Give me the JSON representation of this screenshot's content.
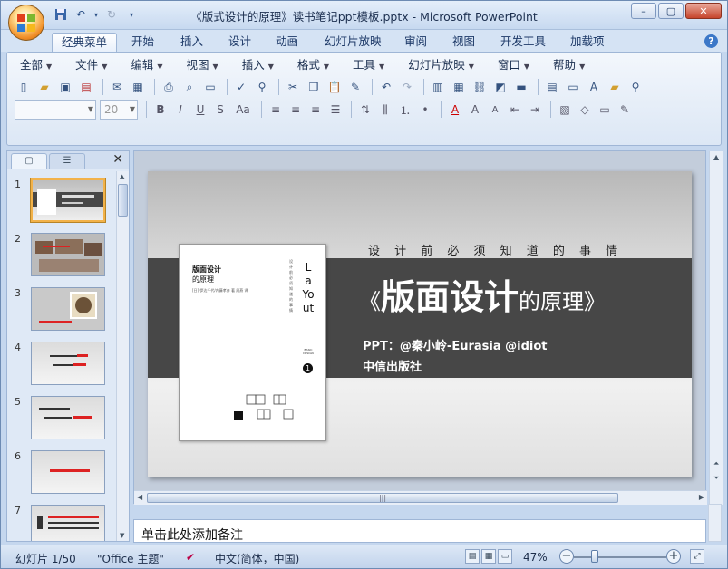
{
  "window": {
    "title": "《版式设计的原理》读书笔记ppt模板.pptx - Microsoft PowerPoint",
    "controls": {
      "minimize": "–",
      "restore": "▢",
      "close": "✕"
    }
  },
  "ribbon_tabs": [
    "经典菜单",
    "开始",
    "插入",
    "设计",
    "动画",
    "幻灯片放映",
    "审阅",
    "视图",
    "开发工具",
    "加载项"
  ],
  "active_tab": "经典菜单",
  "help": "?",
  "menus": [
    "全部",
    "文件",
    "编辑",
    "视图",
    "插入",
    "格式",
    "工具",
    "幻灯片放映",
    "窗口",
    "帮助"
  ],
  "font_size": "20",
  "format_buttons": {
    "bold": "B",
    "italic": "I",
    "underline": "U",
    "strike": "S",
    "case": "Aa"
  },
  "outline_pane": {
    "close": "✕"
  },
  "slides": [
    {
      "num": "1",
      "type": "title"
    },
    {
      "num": "2",
      "type": "photos"
    },
    {
      "num": "3",
      "type": "photo-card"
    },
    {
      "num": "4",
      "type": "text-lines"
    },
    {
      "num": "5",
      "type": "text-lines"
    },
    {
      "num": "6",
      "type": "text-line"
    },
    {
      "num": "7",
      "type": "diagram"
    }
  ],
  "slide": {
    "subtitle": "设 计 前 必 须 知 道 的 事 情",
    "title_open": "《",
    "title_strong": "版面设计",
    "title_light": "的原理",
    "title_close": "》",
    "credit": "PPT：@秦小岭-Eurasia    @idiot",
    "publisher": "中信出版社",
    "book": {
      "title_line1": "版面设计",
      "title_line2": "的原理",
      "author": "[日] 伊达千代/内藤孝彦  著  周燕  译",
      "vertical_word": "LaYout",
      "vertical_sub": "设计前必须知道的事情",
      "series_small": "BASIC DESIGN",
      "series_num": "1"
    }
  },
  "notes": {
    "placeholder": "单击此处添加备注"
  },
  "status": {
    "slide_counter": "幻灯片 1/50",
    "theme": "\"Office 主题\"",
    "language": "中文(简体，中国)",
    "zoom": "47%"
  },
  "colors": {
    "band": "#474747",
    "ribbon": "#dce7f5",
    "frame": "#c5d7ee"
  }
}
